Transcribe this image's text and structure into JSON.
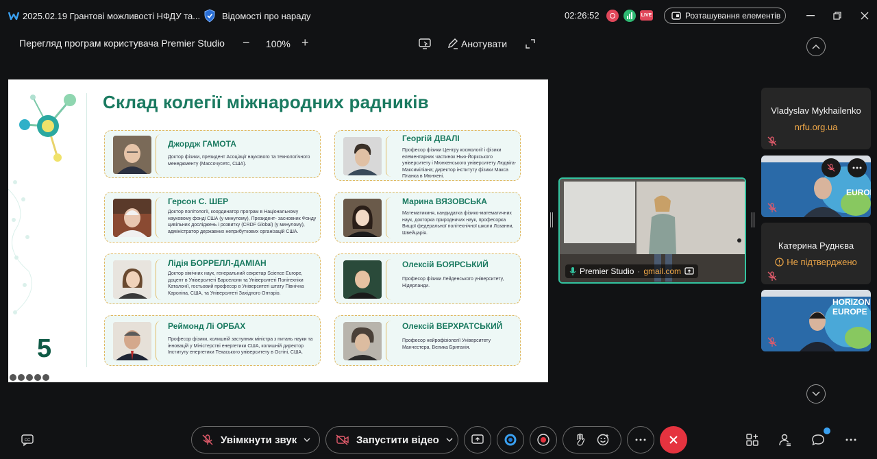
{
  "titlebar": {
    "meeting_title": "2025.02.19 Грантові можливості НФДУ та...",
    "meeting_info": "Відомості про нараду",
    "time": "02:26:52",
    "live_badge": "LIVE",
    "layout_button": "Розташування елементів"
  },
  "viewer": {
    "title": "Перегляд програм користувача Premier Studio",
    "zoom_minus": "−",
    "zoom": "100%",
    "zoom_plus": "+",
    "annotate": "Анотувати"
  },
  "slide": {
    "title": "Склад колегії міжнародних радників",
    "page_number": "5",
    "people": [
      {
        "name": "Джордж ГАМОТА",
        "desc": "Доктор фізики, президент Асоціації наукового та технологічного менеджменту (Массочусетс, США)."
      },
      {
        "name": "Герсон С. ШЕР",
        "desc": "Доктор політології, координатор програм в Національному науковому фонді США (у минулому), Президент- засновник Фонду цивільних досліджень і розвитку (CRDF Global) (у минулому), адміністратор державних неприбуткових організацій США."
      },
      {
        "name": "Лідія БОРРЕЛЛ-ДАМІАН",
        "desc": "Доктор хімічних наук, генеральний секретар Science Europe, доцент в Університеті Барселони та Університеті Політехніки Каталонії, гостьовий професор в Університеті штату Північна Кароліна, США, та Університеті Західного Онтаріо."
      },
      {
        "name": "Реймонд Лі ОРБАХ",
        "desc": "Професор фізики, колишній заступник міністра з питань науки та інновацій у Міністерстві енергетики США, колишній директор Інституту енергетики Техаського університету в Остіні, США."
      },
      {
        "name": "Георгій ДВАЛІ",
        "desc": "Професор фізики Центру космології і фізики елементарних частинок Нью-Йоркського університету і Мюнхенського університету Людвіга-Максиміліана; директор інституту фізики Макса Планка в Мюнхені."
      },
      {
        "name": "Марина ВЯЗОВСЬКА",
        "desc": "Математикиня, кандидатка фізико-математичних наук, докторка природничих наук, професорка Вищої федеральної політехнічної школи Лозанни, Швейцарія."
      },
      {
        "name": "Олексій БОЯРСЬКИЙ",
        "desc": "Професор фізики Лейденського університету, Нідерланди."
      },
      {
        "name": "Олексій ВЕРХРАТСЬКИЙ",
        "desc": "Професор нейрофізіології Університету Манчестера, Велика Британія."
      }
    ]
  },
  "stage": {
    "name": "Premier Studio",
    "email": "gmail.com"
  },
  "participants": [
    {
      "name": "Vladyslav Mykhailenko",
      "sub": "nrfu.org.ua"
    },
    {
      "name": "",
      "sub": ""
    },
    {
      "name": "Катерина Руднєва",
      "sub": "Не підтверджено"
    },
    {
      "name": "",
      "sub": ""
    }
  ],
  "tile_banner": {
    "line1": "HORIZON",
    "line2": "EUROPE"
  },
  "bottombar": {
    "unmute": "Увімкнути звук",
    "start_video": "Запустити відео"
  },
  "colors": {
    "accent_green": "#1a7a60",
    "end_red": "#e5333f",
    "stage_border": "#33c4a0",
    "warning_orange": "#f0a848"
  }
}
